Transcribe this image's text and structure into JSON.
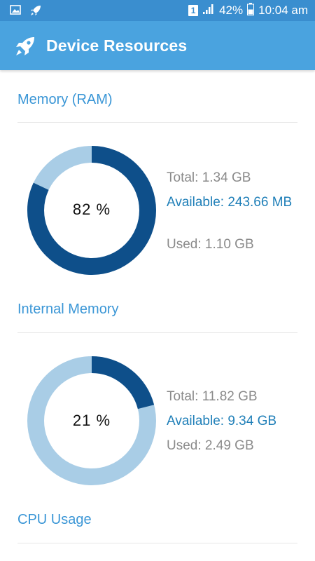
{
  "status_bar": {
    "sim": "1",
    "battery": "42%",
    "time": "10:04 am"
  },
  "app_bar": {
    "title": "Device Resources",
    "icon": "rocket-icon"
  },
  "sections": {
    "ram": {
      "title": "Memory (RAM)",
      "percent_label": "82 %",
      "used_fraction": 0.82,
      "total": "Total: 1.34 GB",
      "available": "Available: 243.66 MB",
      "used": "Used: 1.10 GB"
    },
    "internal": {
      "title": "Internal Memory",
      "percent_label": "21 %",
      "used_fraction": 0.21,
      "total": "Total: 11.82 GB",
      "available": "Available: 9.34 GB",
      "used": "Used: 2.49 GB"
    },
    "cpu": {
      "title": "CPU Usage"
    }
  },
  "colors": {
    "status_bar": "#3a8ecf",
    "app_bar": "#4aa3df",
    "donut_used": "#0e4f8a",
    "donut_free": "#a9cde6",
    "section_title": "#3a96d6",
    "available_text": "#1f7fb8",
    "muted_text": "#8a8a8a"
  }
}
